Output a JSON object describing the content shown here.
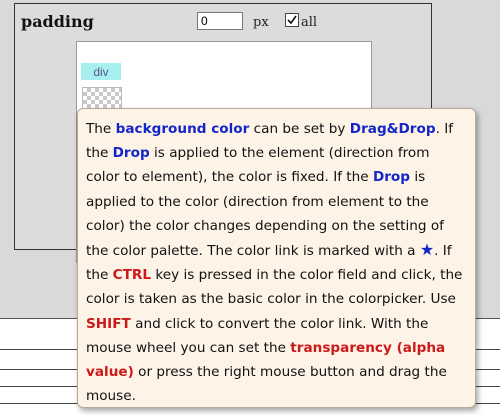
{
  "panel": {
    "title": "padding",
    "value": "0",
    "unit": "px",
    "all_checked": true,
    "all_label": "all"
  },
  "preview": {
    "element_label": "div"
  },
  "tooltip": {
    "t1": "The ",
    "k1": "background color",
    "t2": " can be set by ",
    "k2": "Drag&Drop",
    "t3": ". If the ",
    "k3": "Drop",
    "t4": " is applied to the element (direction from color to element), the color is fixed. If the ",
    "k4": "Drop",
    "t5": " is applied to the color (direction from element to the color) the color changes depending on the setting of the color palette. The color link is marked with a ",
    "star": "★",
    "t6": ". If the ",
    "k5": "CTRL",
    "t7": " key is pressed in the color field and click, the color is taken as the basic color in the colorpicker. Use ",
    "k6": "SHIFT",
    "t8": " and click to convert the color link. With the mouse wheel you can set the ",
    "k7": "transparency (alpha value)",
    "t9": " or press the right mouse button and drag the mouse."
  },
  "colors": {
    "keyword_blue": "#1426c8",
    "keyword_red": "#cc1a1a",
    "tooltip_bg": "#fdf3e7",
    "div_chip_bg": "#a8f0f0"
  }
}
